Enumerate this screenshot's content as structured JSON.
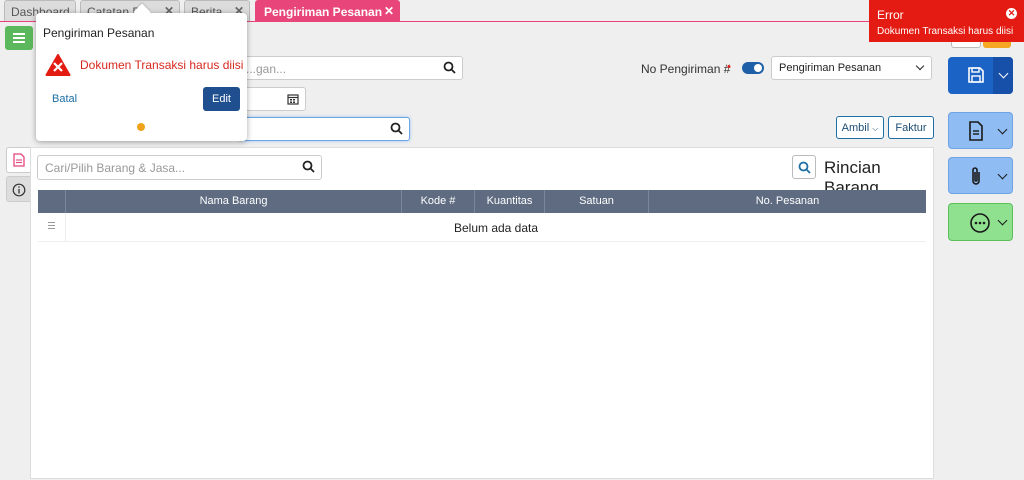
{
  "tabs": [
    {
      "label": "Dashboard"
    },
    {
      "label": "Catatan B..."
    },
    {
      "label": "Berita"
    },
    {
      "label": "Pengiriman Pesanan"
    }
  ],
  "header": {
    "customer_placeholder": "...gan...",
    "no_pengiriman_label": "No Pengiriman #",
    "required_mark": "•",
    "transaction_select": "Pengiriman Pesanan",
    "ambil_label": "Ambil",
    "faktur_label": "Faktur"
  },
  "items": {
    "search_placeholder": "Cari/Pilih Barang & Jasa...",
    "title": "Rincian Barang",
    "columns": [
      "Nama Barang",
      "Kode #",
      "Kuantitas",
      "Satuan",
      "No. Pesanan"
    ],
    "empty_text": "Belum ada data"
  },
  "popup": {
    "title": "Pengiriman Pesanan",
    "message": "Dokumen Transaksi harus diisi",
    "cancel_label": "Batal",
    "edit_label": "Edit"
  },
  "toast": {
    "title": "Error",
    "message": "Dokumen Transaksi harus diisi"
  },
  "colors": {
    "accent": "#e8457a",
    "error": "#e31b12",
    "save": "#1b63c4",
    "header": "#5e6b81"
  }
}
